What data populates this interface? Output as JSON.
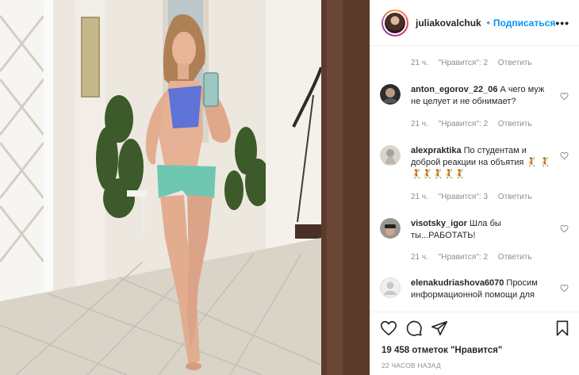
{
  "header": {
    "username": "juliakovalchuk",
    "follow_label": "Подписаться",
    "separator": "•",
    "more_label": "•••"
  },
  "top_meta": {
    "time": "21 ч.",
    "likes": "\"Нравится\": 2",
    "reply": "Ответить"
  },
  "comments": [
    {
      "user": "anton_egorov_22_06",
      "text": "А чего муж не целует и не обнимает?",
      "time": "21 ч.",
      "likes": "\"Нравится\": 2",
      "reply": "Ответить"
    },
    {
      "user": "alexpraktika",
      "text": "По студентам и доброй реакции на объятия 🤾 🤾🤾🤾🤾🤾🤾",
      "time": "21 ч.",
      "likes": "\"Нравится\": 3",
      "reply": "Ответить"
    },
    {
      "user": "visotsky_igor",
      "text": "Шла бы ты...РАБОТАТЬ!",
      "time": "21 ч.",
      "likes": "\"Нравится\": 2",
      "reply": "Ответить"
    },
    {
      "user": "elenakudriashova6070",
      "text": "Просим информационной помощи для"
    }
  ],
  "likes_text": "19 458 отметок \"Нравится\"",
  "timestamp": "22 ЧАСОВ НАЗАД",
  "colors": {
    "link": "#0095f6",
    "secondary": "#8e8e8e",
    "border": "#efefef",
    "verified": "#3897f0"
  }
}
